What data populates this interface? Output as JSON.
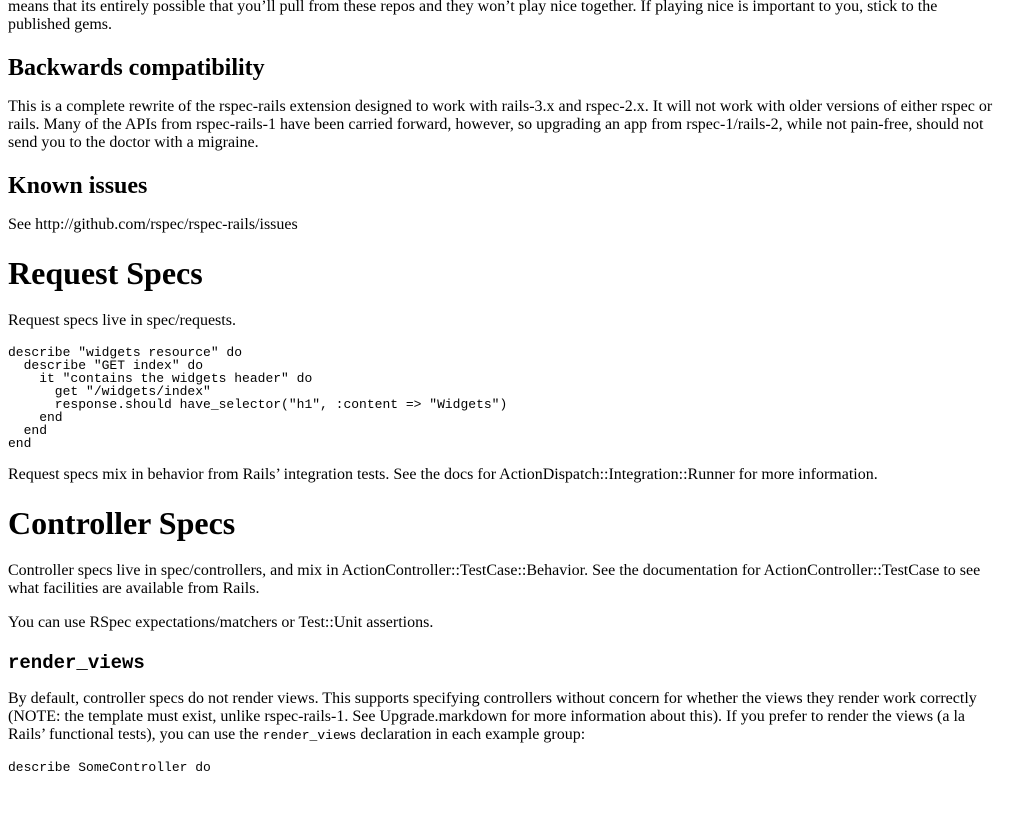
{
  "doc": {
    "intro_tail": "means that its entirely possible that you’ll pull from these repos and they won’t play nice together. If playing nice is important to you, stick to the published gems.",
    "backwards": {
      "heading": "Backwards compatibility",
      "text": "This is a complete rewrite of the rspec-rails extension designed to work with rails-3.x and rspec-2.x. It will not work with older versions of either rspec or rails. Many of the APIs from rspec-rails-1 have been carried forward, however, so upgrading an app from rspec-1/rails-2, while not pain-free, should not send you to the doctor with a migraine."
    },
    "known_issues": {
      "heading": "Known issues",
      "text": "See http://github.com/rspec/rspec-rails/issues"
    },
    "request_specs": {
      "heading": "Request Specs",
      "intro": "Request specs live in spec/requests.",
      "code": "describe \"widgets resource\" do\n  describe \"GET index\" do\n    it \"contains the widgets header\" do\n      get \"/widgets/index\"\n      response.should have_selector(\"h1\", :content => \"Widgets\")\n    end\n  end\nend",
      "outro": "Request specs mix in behavior from Rails’ integration tests. See the docs for ActionDispatch::Integration::Runner for more information."
    },
    "controller_specs": {
      "heading": "Controller Specs",
      "intro": "Controller specs live in spec/controllers, and mix in ActionController::TestCase::Behavior. See the documentation for ActionController::TestCase to see what facilities are available from Rails.",
      "assertions": "You can use RSpec expectations/matchers or Test::Unit assertions."
    },
    "render_views": {
      "heading": "render_views",
      "text_before": "By default, controller specs do not render views. This supports specifying controllers without concern for whether the views they render work correctly (NOTE: the template must exist, unlike rspec-rails-1. See Upgrade.markdown for more information about this). If you prefer to render the views (a la Rails’ functional tests), you can use the ",
      "inline_code": "render_views",
      "text_after": " declaration in each example group:",
      "code": "describe SomeController do"
    }
  }
}
